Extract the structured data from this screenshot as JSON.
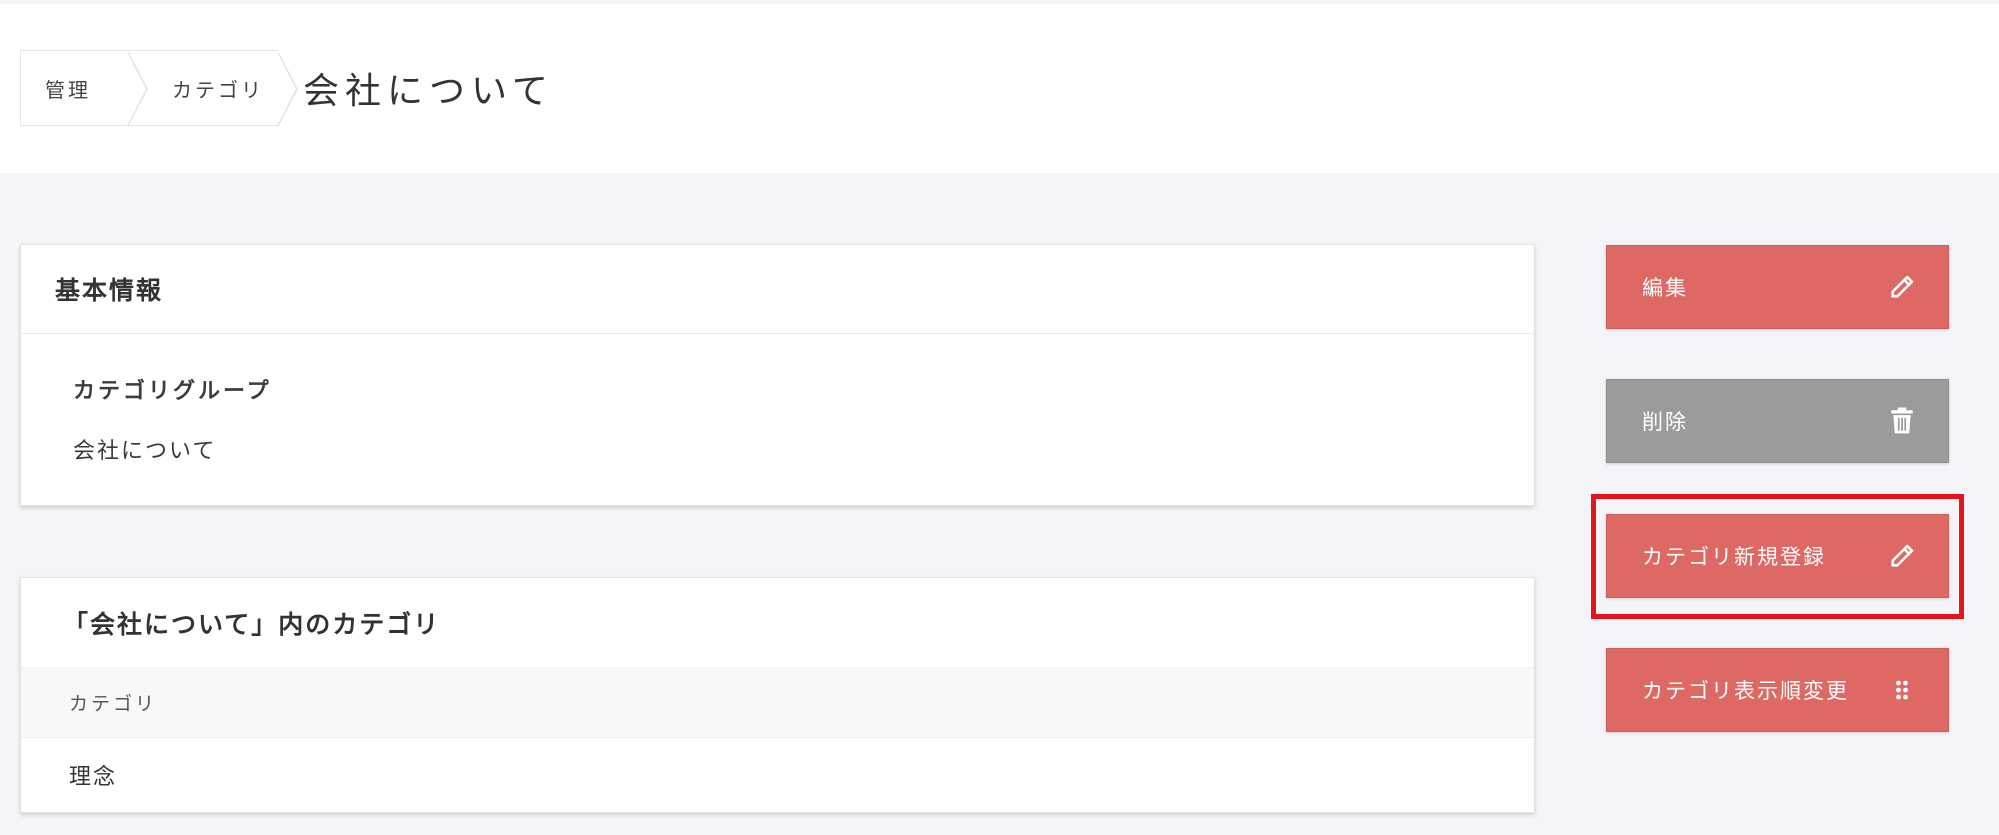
{
  "breadcrumb": {
    "items": [
      "管理",
      "カテゴリ"
    ],
    "current": "会社について"
  },
  "basic_info": {
    "title": "基本情報",
    "group_label": "カテゴリグループ",
    "group_value": "会社について"
  },
  "categories": {
    "title": "「会社について」内のカテゴリ",
    "column_header": "カテゴリ",
    "rows": [
      "理念"
    ]
  },
  "actions": {
    "edit": {
      "label": "編集",
      "icon": "pencil-icon"
    },
    "delete": {
      "label": "削除",
      "icon": "trash-icon"
    },
    "new_category": {
      "label": "カテゴリ新規登録",
      "icon": "pencil-icon"
    },
    "reorder": {
      "label": "カテゴリ表示順変更",
      "icon": "drag-handle-icon"
    }
  },
  "colors": {
    "primary": "#dd6864",
    "secondary": "#9b9b9b",
    "highlight": "#e8121c"
  }
}
